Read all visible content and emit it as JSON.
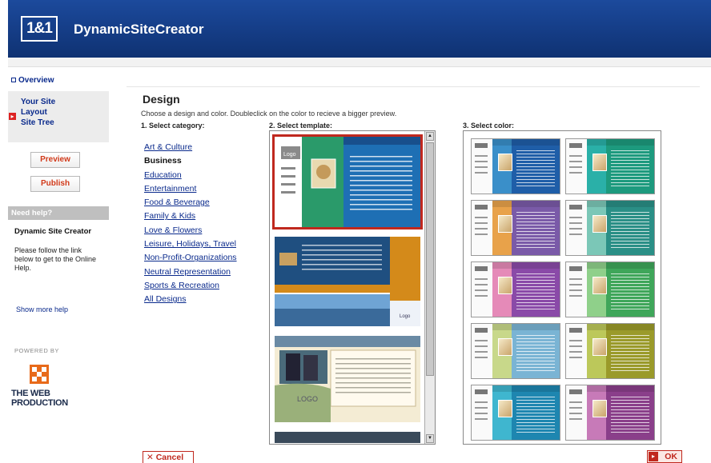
{
  "header": {
    "logo": "1&1",
    "title": "DynamicSiteCreator"
  },
  "sidebar": {
    "overview": "Overview",
    "nav": [
      "Your Site",
      "Layout",
      "Site Tree"
    ],
    "preview_label": "Preview",
    "publish_label": "Publish",
    "help_bar": "Need help?",
    "help_title": "Dynamic Site Creator",
    "help_text": "Please follow the link below to get to the Online Help.",
    "help_more": "Show more help",
    "powered_by": "POWERED BY",
    "company": "THE WEB PRODUCTION"
  },
  "main": {
    "title": "Design",
    "description": "Choose a design and color. Doubleclick on the color to recieve a bigger preview.",
    "step1": "1. Select category:",
    "step2": "2. Select template:",
    "step3": "3. Select color:",
    "categories": [
      "Art & Culture",
      "Business",
      "Education",
      "Entertainment",
      "Food & Beverage",
      "Family & Kids",
      "Love & Flowers",
      "Leisure, Holidays, Travel",
      "Non-Profit-Organizations",
      "Neutral Representation",
      "Sports & Recreation",
      "All Designs"
    ],
    "selected_category": "Business",
    "template_texts": {
      "t1_logo": "Logo",
      "t2_logo": "Logo",
      "t3_logo": "LOGO"
    },
    "colors": [
      [
        "#3a8fc9",
        "#1f5ea8"
      ],
      [
        "#2ab0a8",
        "#1d9a7e"
      ],
      [
        "#e8a24a",
        "#7a5aa8"
      ],
      [
        "#7bc7b7",
        "#2a8f86"
      ],
      [
        "#e58ab8",
        "#8a4aa8"
      ],
      [
        "#8fd08a",
        "#3fa65a"
      ],
      [
        "#c8d88a",
        "#7ab4d4"
      ],
      [
        "#bcc85a",
        "#9a9a2a"
      ],
      [
        "#3fb6cf",
        "#1e86b0"
      ],
      [
        "#c77ab8",
        "#8a3f8a"
      ]
    ]
  },
  "footer": {
    "cancel_label": "Cancel",
    "ok_label": "OK"
  }
}
